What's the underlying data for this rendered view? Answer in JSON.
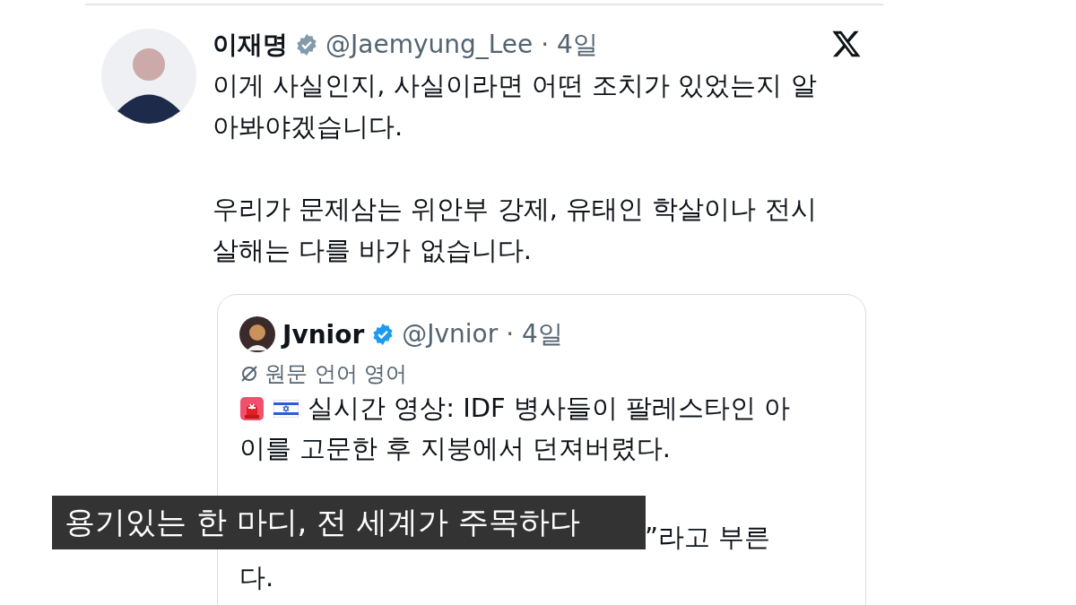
{
  "post": {
    "author": "이재명",
    "verified": true,
    "handle_time": "@Jaemyung_Lee · 4일",
    "paragraphs": [
      "이게 사실인지, 사실이라면 어떤 조치가 있었는지 알아봐야겠습니다.",
      "우리가 문제삼는 위안부 강제, 유태인 학살이나 전시 살해는 다를 바가 없습니다."
    ]
  },
  "quote": {
    "author": "Jvnior",
    "verified": true,
    "handle_time": "@Jvnior · 4일",
    "translation_note": "원문 언어 영어",
    "lines": [
      "실시간 영상: IDF 병사들이 팔레스타인 아",
      "이를 고문한 후 지붕에서 던져버렸다.",
      "”라고 부른",
      "다."
    ]
  },
  "caption": "용기있는 한 마디, 전 세계가 주목하다"
}
